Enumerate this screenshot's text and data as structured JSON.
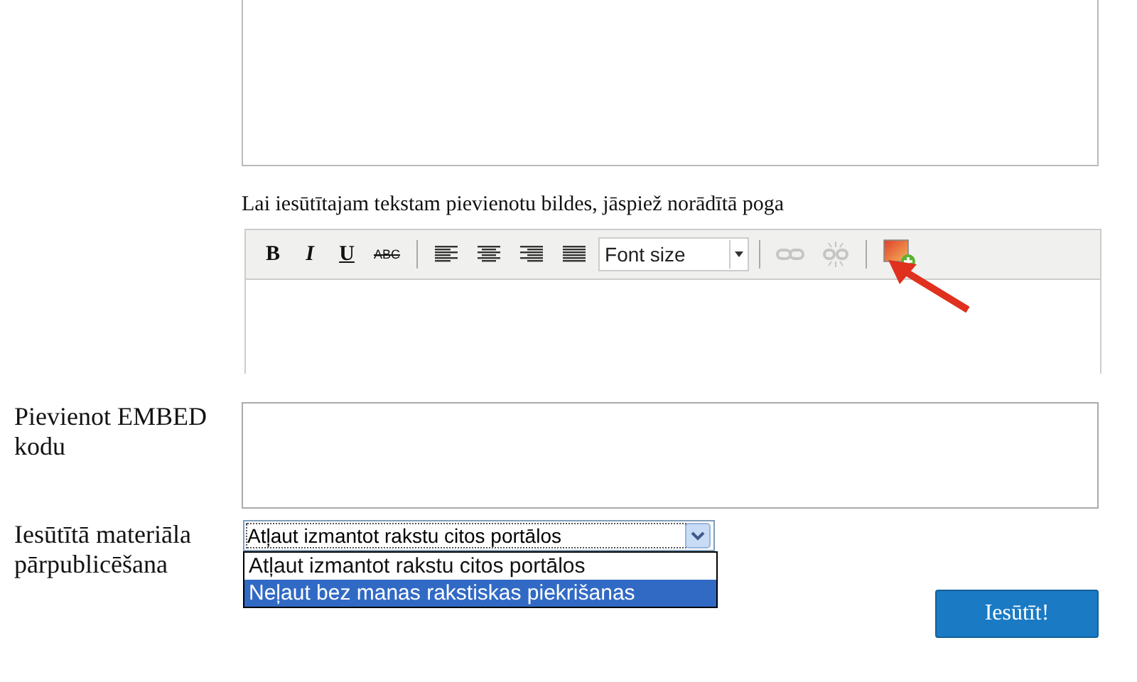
{
  "caption": "Lai iesūtītajam tekstam pievienotu bildes, jāspiež norādītā poga",
  "toolbar": [
    {
      "kind": "bold",
      "label": "B"
    },
    {
      "kind": "italic",
      "label": "I"
    },
    {
      "kind": "underline",
      "label": "U"
    },
    {
      "kind": "strike",
      "label": "ABC"
    },
    {
      "kind": "separator"
    },
    {
      "kind": "align-left"
    },
    {
      "kind": "align-center"
    },
    {
      "kind": "align-right"
    },
    {
      "kind": "align-justify"
    },
    {
      "kind": "select",
      "value": "Font size"
    },
    {
      "kind": "separator"
    },
    {
      "kind": "link",
      "disabled": true
    },
    {
      "kind": "unlink",
      "disabled": true
    },
    {
      "kind": "separator"
    },
    {
      "kind": "image",
      "disabled": false
    }
  ],
  "embed": {
    "label": "Pievienot EMBED kodu"
  },
  "republish": {
    "label": "Iesūtītā materiāla pārpublicēšana",
    "value": "Atļaut izmantot rakstu citos portālos",
    "expanded": true,
    "options": [
      {
        "label": "Atļaut izmantot rakstu citos portālos",
        "highlighted": false
      },
      {
        "label": "Neļaut bez manas rakstiskas piekrišanas",
        "highlighted": true
      }
    ]
  },
  "submit": "Iesūtīt!"
}
